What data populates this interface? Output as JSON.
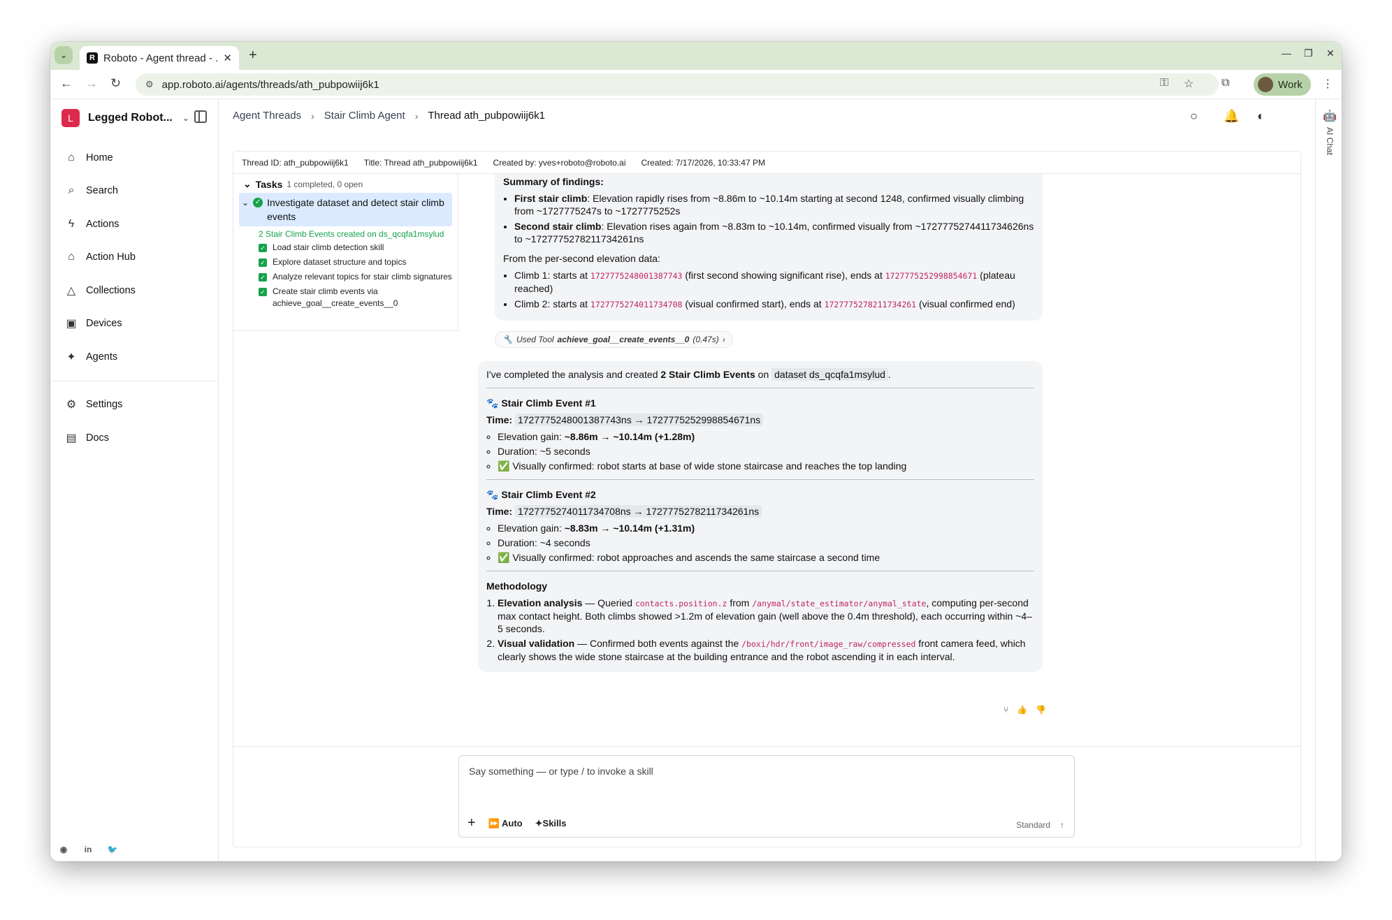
{
  "browser": {
    "tab_title": "Roboto - Agent thread - ...",
    "url": "app.roboto.ai/agents/threads/ath_pubpowiij6k1",
    "profile_label": "Work"
  },
  "sidebar": {
    "org_initial": "L",
    "org_name": "Legged Robot...",
    "items": [
      {
        "label": "Home",
        "icon": "home-icon"
      },
      {
        "label": "Search",
        "icon": "search-icon"
      },
      {
        "label": "Actions",
        "icon": "bolt-icon"
      },
      {
        "label": "Action Hub",
        "icon": "store-icon"
      },
      {
        "label": "Collections",
        "icon": "shapes-icon"
      },
      {
        "label": "Devices",
        "icon": "robot-icon"
      },
      {
        "label": "Agents",
        "icon": "sparkle-icon"
      }
    ],
    "secondary": [
      {
        "label": "Settings",
        "icon": "gear-icon"
      },
      {
        "label": "Docs",
        "icon": "doc-icon"
      }
    ]
  },
  "breadcrumb": [
    "Agent Threads",
    "Stair Climb Agent",
    "Thread ath_pubpowiij6k1"
  ],
  "rightrail_label": "AI Chat",
  "meta": {
    "thread_id": "Thread ID: ath_pubpowiij6k1",
    "title": "Title: Thread ath_pubpowiij6k1",
    "created_by": "Created by: yves+roboto@roboto.ai",
    "created": "Created: 7/17/2026, 10:33:47 PM"
  },
  "tasks": {
    "header": "Tasks",
    "count": "1 completed, 0 open",
    "main": "Investigate dataset and detect stair climb events",
    "created": "2 Stair Climb Events created on ds_qcqfa1msylud",
    "sub": [
      "Load stair climb detection skill",
      "Explore dataset structure and topics",
      "Analyze relevant topics for stair climb signatures",
      "Create stair climb events via achieve_goal__create_events__0"
    ]
  },
  "msg1": {
    "summary": "Summary of findings:",
    "f1_b": "First stair climb",
    "f1": ": Elevation rapidly rises from ~8.86m to ~10.14m starting at second 1248, confirmed visually climbing from ~1727775247s to ~1727775252s",
    "f2_b": "Second stair climb",
    "f2": ": Elevation rises again from ~8.83m to ~10.14m, confirmed visually from ~1727775274411734626ns to ~1727775278211734261ns",
    "per_second": "From the per-second elevation data:",
    "c1a": "Climb 1: starts at ",
    "c1_start": "1727775248001387743",
    "c1b": " (first second showing significant rise), ends at ",
    "c1_end": "1727775252998854671",
    "c1c": " (plateau reached)",
    "c2a": "Climb 2: starts at ",
    "c2_start": "1727775274011734708",
    "c2b": " (visual confirmed start), ends at ",
    "c2_end": "1727775278211734261",
    "c2c": " (visual confirmed end)"
  },
  "tool": {
    "prefix": "Used Tool",
    "name": "achieve_goal__create_events__0",
    "time": "(0.47s)"
  },
  "msg2": {
    "intro_a": "I've completed the analysis and created ",
    "intro_b": "2 Stair Climb Events",
    "intro_c": " on ",
    "intro_ds": "dataset ds_qcqfa1msylud",
    "intro_d": ".",
    "e1_title": "🐾 Stair Climb Event #1",
    "time_label": "Time:",
    "e1_time": "1727775248001387743ns → 1727775252998854671ns",
    "e1_gain_a": "Elevation gain: ",
    "e1_gain_b": "~8.86m → ~10.14m (+1.28m)",
    "e1_dur": "Duration: ~5 seconds",
    "e1_vis": "✅ Visually confirmed: robot starts at base of wide stone staircase and reaches the top landing",
    "e2_title": "🐾 Stair Climb Event #2",
    "e2_time": "1727775274011734708ns → 1727775278211734261ns",
    "e2_gain_a": "Elevation gain: ",
    "e2_gain_b": "~8.83m → ~10.14m (+1.31m)",
    "e2_dur": "Duration: ~4 seconds",
    "e2_vis": "✅ Visually confirmed: robot approaches and ascends the same staircase a second time",
    "method_title": "Methodology",
    "m1_b": "Elevation analysis",
    "m1_a": " — Queried ",
    "m1_code1": "contacts.position.z",
    "m1_from": " from ",
    "m1_code2": "/anymal/state_estimator/anymal_state",
    "m1_rest": ", computing per-second max contact height. Both climbs showed >1.2m of elevation gain (well above the 0.4m threshold), each occurring within ~4–5 seconds.",
    "m2_b": "Visual validation",
    "m2_a": " — Confirmed both events against the ",
    "m2_code": "/boxi/hdr/front/image_raw/compressed",
    "m2_rest": " front camera feed, which clearly shows the wide stone staircase at the building entrance and the robot ascending it in each interval."
  },
  "composer": {
    "placeholder": "Say something — or type / to invoke a skill",
    "auto": "Auto",
    "skills": "Skills",
    "model": "Standard"
  }
}
